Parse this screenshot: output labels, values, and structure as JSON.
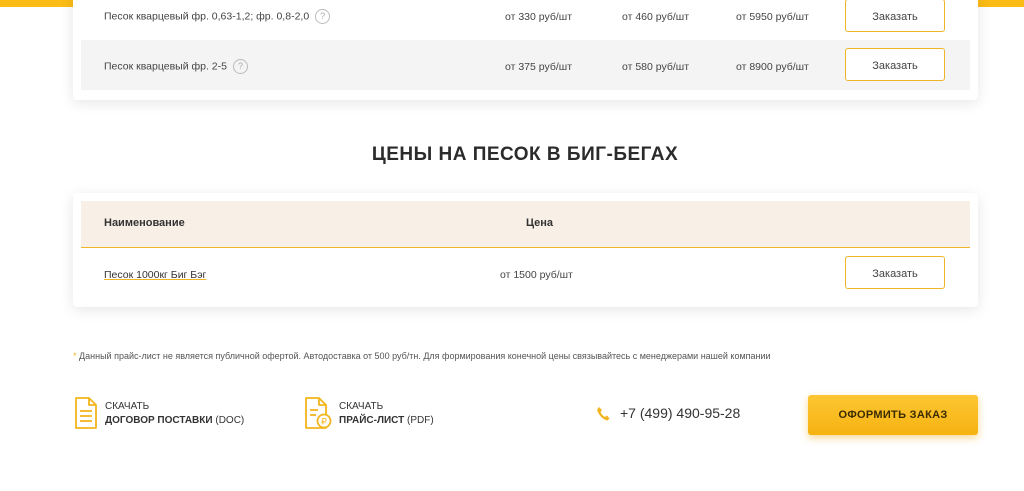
{
  "table1": {
    "rows": [
      {
        "name": "Песок кварцевый фр. 0,63-1,2; фр. 0,8-2,0",
        "p1": "от 330 руб/шт",
        "p2": "от 460 руб/шт",
        "p3": "от 5950 руб/шт",
        "button": "Заказать"
      },
      {
        "name": "Песок кварцевый фр. 2-5",
        "p1": "от 375 руб/шт",
        "p2": "от 580 руб/шт",
        "p3": "от 8900 руб/шт",
        "button": "Заказать"
      }
    ],
    "help_glyph": "?"
  },
  "section": {
    "title": "ЦЕНЫ НА ПЕСОК В БИГ-БЕГАХ"
  },
  "table2": {
    "headers": {
      "name": "Наименование",
      "price": "Цена"
    },
    "rows": [
      {
        "name": "Песок 1000кг Биг Бэг",
        "price": "от 1500 руб/шт",
        "button": "Заказать"
      }
    ]
  },
  "note": {
    "star": "*",
    "text": "Данный прайс-лист не является публичной офертой. Автодоставка от 500 руб/тн. Для формирования конечной цены связывайтесь с менеджерами нашей компании"
  },
  "downloads": [
    {
      "action": "СКАЧАТЬ",
      "title": "ДОГОВОР ПОСТАВКИ",
      "format": "(DOC)",
      "icon": "document-icon"
    },
    {
      "action": "СКАЧАТЬ",
      "title": "ПРАЙС-ЛИСТ",
      "format": "(PDF)",
      "icon": "price-document-icon"
    }
  ],
  "contact": {
    "phone": "+7 (499) 490-95-28",
    "icon": "phone-icon"
  },
  "cta": {
    "label": "ОФОРМИТЬ ЗАКАЗ"
  },
  "colors": {
    "accent": "#fbbc15",
    "header_bg": "#f8efe6",
    "row_alt": "#f4f4f4"
  }
}
